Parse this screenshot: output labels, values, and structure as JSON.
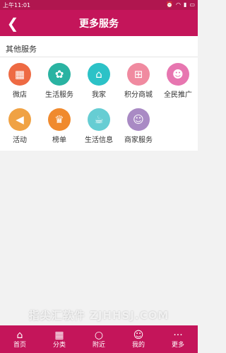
{
  "status": {
    "time": "上午11:01"
  },
  "header": {
    "back_icon": "chevron-left-icon",
    "title": "更多服务"
  },
  "section": {
    "title": "其他服务",
    "items": [
      {
        "label": "微店",
        "icon": "shop-icon",
        "glyph": "▦",
        "color": "#ee6a43"
      },
      {
        "label": "生活服务",
        "icon": "flower-icon",
        "glyph": "✿",
        "color": "#2ab3a2"
      },
      {
        "label": "我家",
        "icon": "home-icon",
        "glyph": "⌂",
        "color": "#2cc2c7"
      },
      {
        "label": "积分商城",
        "icon": "gift-icon",
        "glyph": "⊞",
        "color": "#f08aa0"
      },
      {
        "label": "全民推广",
        "icon": "person-icon",
        "glyph": "☻",
        "color": "#e776b0"
      },
      {
        "label": "活动",
        "icon": "megaphone-icon",
        "glyph": "◀",
        "color": "#f0a244"
      },
      {
        "label": "榜单",
        "icon": "podium-icon",
        "glyph": "♛",
        "color": "#f08a2e"
      },
      {
        "label": "生活信息",
        "icon": "coffee-icon",
        "glyph": "☕",
        "color": "#66cdd3"
      },
      {
        "label": "商家服务",
        "icon": "merchant-icon",
        "glyph": "☺",
        "color": "#a98ac4"
      }
    ]
  },
  "nav": {
    "items": [
      {
        "label": "首页",
        "icon": "home-nav-icon",
        "glyph": "⌂"
      },
      {
        "label": "分类",
        "icon": "grid-nav-icon",
        "glyph": "▦"
      },
      {
        "label": "附近",
        "icon": "search-nav-icon",
        "glyph": "○"
      },
      {
        "label": "我的",
        "icon": "user-nav-icon",
        "glyph": "☺"
      },
      {
        "label": "更多",
        "icon": "more-nav-icon",
        "glyph": "···"
      }
    ]
  },
  "watermark": "指尖汇软件 ZJHHSJ.COM",
  "colors": {
    "primary": "#c4155a",
    "status_bar": "#b0164f"
  }
}
